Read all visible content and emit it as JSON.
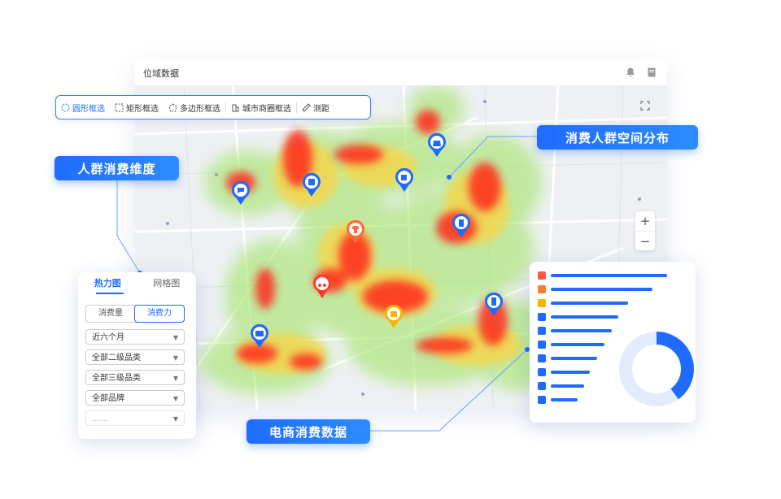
{
  "window": {
    "title": "位域数据"
  },
  "toolbar": {
    "tools": [
      {
        "label": "圆形框选",
        "icon": "circle-select-icon",
        "active": true
      },
      {
        "label": "矩形框选",
        "icon": "rect-select-icon",
        "active": false
      },
      {
        "label": "多边形框选",
        "icon": "polygon-select-icon",
        "active": false
      },
      {
        "label": "城市商圈框选",
        "icon": "building-icon",
        "active": false
      },
      {
        "label": "测距",
        "icon": "ruler-icon",
        "active": false
      }
    ]
  },
  "callouts": {
    "top_right": "消费人群空间分布",
    "left": "人群消费维度",
    "bottom": "电商消费数据"
  },
  "left_panel": {
    "tabs": [
      "热力图",
      "网格图"
    ],
    "segments": [
      "消费量",
      "消费力"
    ],
    "selects": [
      "近六个月",
      "全部二级品类",
      "全部三级品类",
      "全部品牌",
      "……"
    ]
  },
  "right_panel": {
    "bar_values": [
      0.95,
      0.83,
      0.63,
      0.55,
      0.5,
      0.44,
      0.38,
      0.32,
      0.27,
      0.22
    ],
    "bar_icon_colors": [
      "#ff5a3c",
      "#ff7a2e",
      "#f7b500",
      "#1f6bff",
      "#1f6bff",
      "#1f6bff",
      "#1f6bff",
      "#1f6bff",
      "#1f6bff",
      "#1f6bff"
    ],
    "donut_fraction": 0.4
  },
  "map": {
    "markers": [
      "chat-icon",
      "book-icon",
      "bag-icon",
      "cup-icon",
      "shirt-icon",
      "scooter-icon",
      "gift-icon",
      "box-icon",
      "fridge-icon",
      "tv-icon"
    ]
  },
  "colors": {
    "accent": "#1f6bff"
  }
}
